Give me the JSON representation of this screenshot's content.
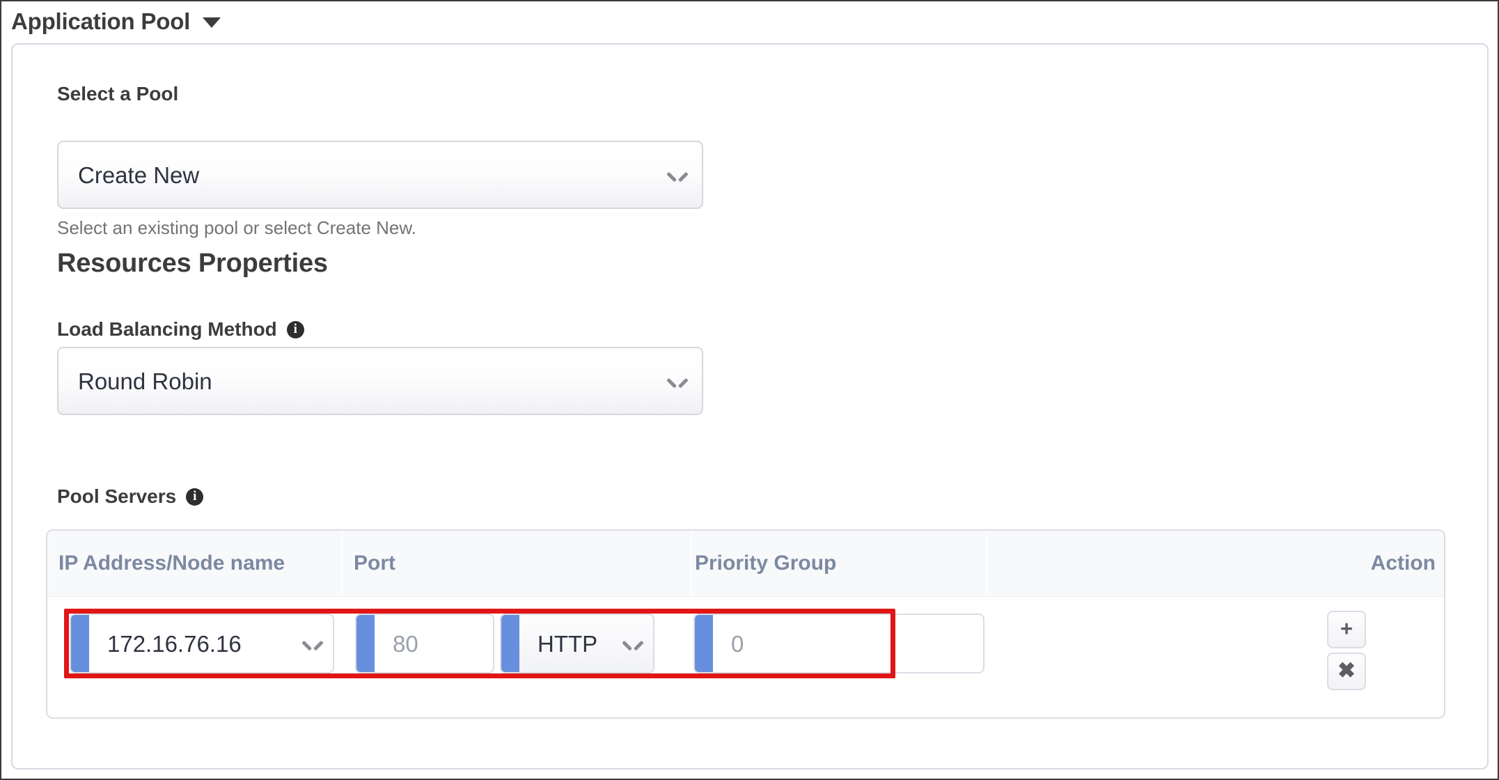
{
  "header": {
    "title": "Application Pool",
    "caret_icon": "caret-down-icon"
  },
  "form": {
    "select_pool": {
      "label": "Select a Pool",
      "value": "Create New",
      "helper": "Select an existing pool or select Create New.",
      "chevron_icon": "chevron-down-icon"
    },
    "resources_properties_heading": "Resources Properties",
    "load_balancing_method": {
      "label": "Load Balancing Method",
      "info_icon": "info-icon",
      "info_glyph": "i",
      "value": "Round Robin",
      "chevron_icon": "chevron-down-icon"
    },
    "pool_servers": {
      "label": "Pool Servers",
      "info_icon": "info-icon",
      "info_glyph": "i"
    }
  },
  "table": {
    "columns": [
      "IP Address/Node name",
      "Port",
      "Priority Group",
      "Action"
    ],
    "rows": [
      {
        "ip_address": "172.16.76.16",
        "port": "80",
        "protocol": "HTTP",
        "priority_group": "0",
        "add_label": "+",
        "remove_label": "✖"
      }
    ]
  },
  "colors": {
    "accent_blue": "#6690dd",
    "highlight_red": "#e11616",
    "header_text": "#7c89a2",
    "border": "#dcdce4"
  }
}
